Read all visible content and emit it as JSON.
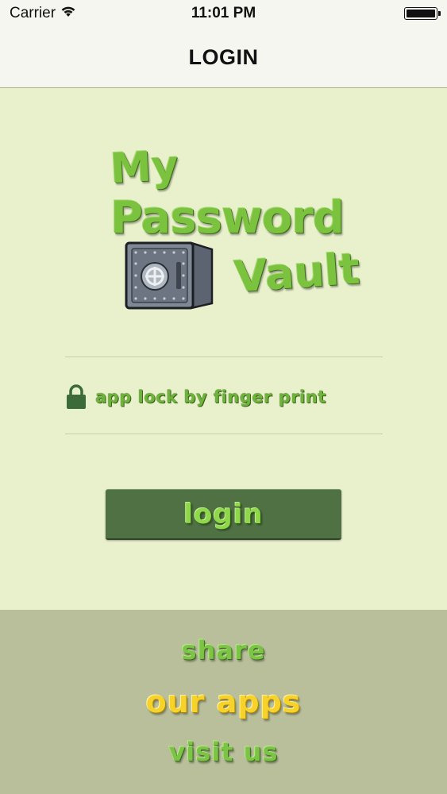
{
  "status_bar": {
    "carrier": "Carrier",
    "time": "11:01 PM",
    "icons": [
      "wifi-icon",
      "battery-icon"
    ]
  },
  "nav": {
    "title": "LOGIN"
  },
  "logo": {
    "line1": "My",
    "line2": "Password",
    "line3": "Vault",
    "icon": "safe-icon"
  },
  "fingerprint": {
    "icon": "lock-icon",
    "label": "app lock by finger print"
  },
  "login_button": {
    "label": "login"
  },
  "footer": {
    "share": "share",
    "our_apps": "our apps",
    "visit_us": "visit us"
  },
  "colors": {
    "background": "#e8f0cc",
    "bar_background": "#f6f6f1",
    "button": "#4f7143",
    "accent_green": "#7cc445",
    "accent_yellow": "#f6d22a",
    "footer": "#b8bf9a"
  }
}
